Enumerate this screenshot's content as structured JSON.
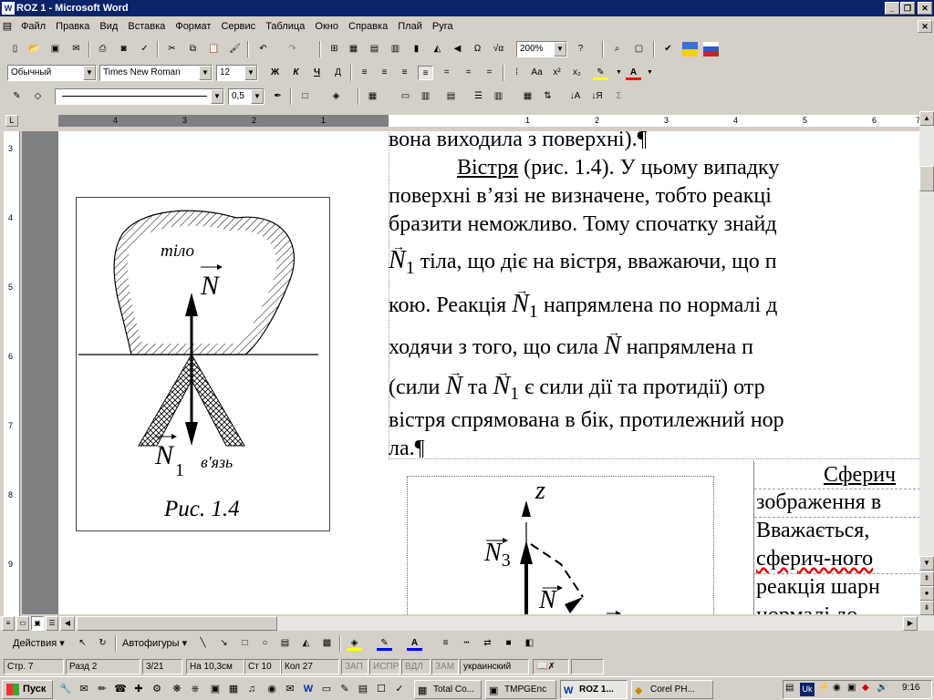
{
  "window": {
    "title": "ROZ 1 - Microsoft Word"
  },
  "menu": [
    "Файл",
    "Правка",
    "Вид",
    "Вставка",
    "Формат",
    "Сервис",
    "Таблица",
    "Окно",
    "Справка",
    "Плай",
    "Руга"
  ],
  "toolbar": {
    "zoom": "200%"
  },
  "format": {
    "style": "Обычный",
    "font": "Times New Roman",
    "size": "12",
    "bold": "Ж",
    "italic": "К",
    "underline": "Ч"
  },
  "drawing_bar": {
    "line_width": "0,5"
  },
  "ruler": {
    "h_labels": [
      "4",
      "3",
      "2",
      "1",
      "1",
      "2",
      "3",
      "4",
      "5",
      "6",
      "7"
    ],
    "v_labels": [
      "3",
      "4",
      "5",
      "6",
      "7",
      "8",
      "9"
    ]
  },
  "figure": {
    "body_label": "тіло",
    "constraint_label": "в'язь",
    "caption": "Рис. 1.4",
    "force": "N",
    "force1": "N",
    "sub1": "1"
  },
  "doc": {
    "line1": "вона виходила з поверхні).¶",
    "line2_term": "Вістря",
    "line2_rest": " (рис. 1.4). У цьому випадку",
    "line3": "поверхні в’язі не визначене, тобто реакці",
    "line4": "бразити неможливо. Тому спочатку знайд",
    "line5": " тіла, що діє на вістря, вважаючи, що п",
    "line6a": "кою. Реакція ",
    "line6b": " напрямлена по нормалі д",
    "line7a": "ходячи з того, що сила ",
    "line7b": " напрямлена п",
    "line8a": "(сили ",
    "line8b": " та ",
    "line8c": " є сили дії та протидії) отр",
    "line9": "вістря спрямована в бік, протилежний нор",
    "line10": "ла.¶",
    "r1": "Сферич",
    "r2": "зображення в",
    "r3": "Вважається,",
    "r4": "сферич-ного",
    "r5": "реакція шарн",
    "r6": "нормалі до",
    "sym_N": "N",
    "sym_sub1": "1",
    "fig2_z": "z",
    "fig2_N3": "N",
    "fig2_sub3": "3",
    "fig2_N": "N"
  },
  "bottom_draw": {
    "actions": "Действия",
    "autoshapes": "Автофигуры"
  },
  "status": {
    "page": "Стр. 7",
    "section": "Разд 2",
    "pages": "3/21",
    "at": "На 10,3см",
    "line": "Ст 10",
    "col": "Кол 27",
    "rec": "ЗАП",
    "trk": "ИСПР",
    "ext": "ВДЛ",
    "ovr": "ЗАМ",
    "lang": "украинский"
  },
  "taskbar": {
    "start": "Пуск",
    "items": [
      "Total Co...",
      "TMPGEnc",
      "ROZ 1...",
      "Corel PH..."
    ],
    "tray_lang": "Uk",
    "clock": "9:16"
  }
}
